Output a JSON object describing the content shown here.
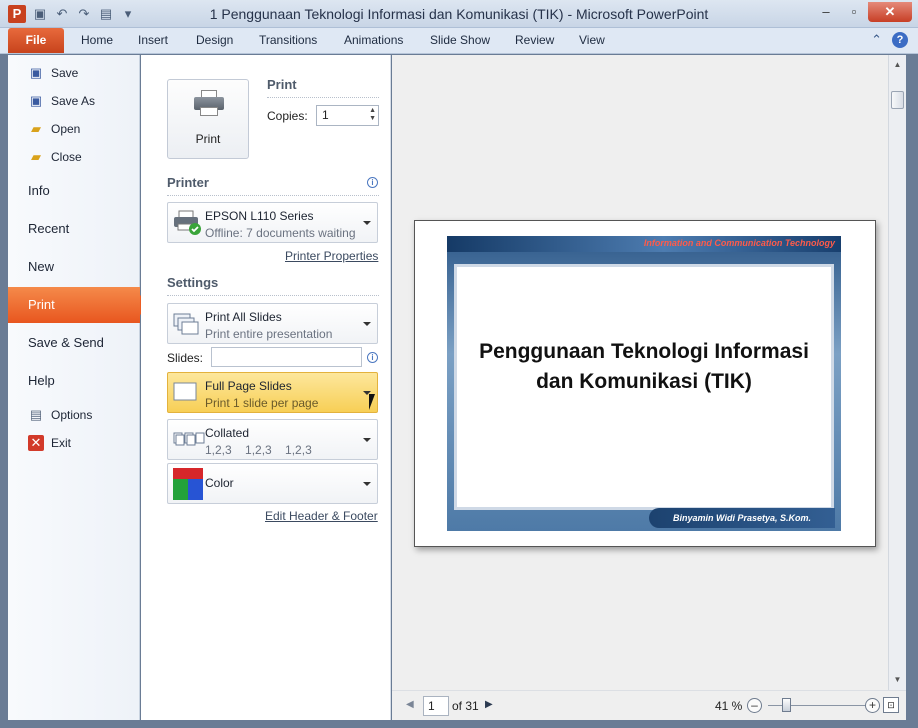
{
  "window": {
    "title": "1 Penggunaan Teknologi Informasi dan Komunikasi (TIK)  -  Microsoft PowerPoint",
    "app_icon_letter": "P"
  },
  "ribbon": {
    "file_label": "File",
    "tabs": [
      "Home",
      "Insert",
      "Design",
      "Transitions",
      "Animations",
      "Slide Show",
      "Review",
      "View"
    ]
  },
  "nav": {
    "commands": [
      {
        "label": "Save",
        "icon": "save-icon"
      },
      {
        "label": "Save As",
        "icon": "save-as-icon"
      },
      {
        "label": "Open",
        "icon": "open-folder-icon"
      },
      {
        "label": "Close",
        "icon": "close-folder-icon"
      }
    ],
    "items": [
      "Info",
      "Recent",
      "New",
      "Print",
      "Save & Send",
      "Help"
    ],
    "lower_commands": [
      {
        "label": "Options",
        "icon": "options-icon"
      },
      {
        "label": "Exit",
        "icon": "exit-icon"
      }
    ]
  },
  "print": {
    "section_title": "Print",
    "button_label": "Print",
    "copies_label": "Copies:",
    "copies_value": "1"
  },
  "printer": {
    "section_title": "Printer",
    "name": "EPSON L110 Series",
    "status": "Offline: 7 documents waiting",
    "properties_link": "Printer Properties"
  },
  "settings": {
    "section_title": "Settings",
    "slides_range": {
      "title": "Print All Slides",
      "subtitle": "Print entire presentation"
    },
    "slides_label": "Slides:",
    "slides_value": "",
    "layout": {
      "title": "Full Page Slides",
      "subtitle": "Print 1 slide per page"
    },
    "collation": {
      "title": "Collated",
      "subtitle": "1,2,3    1,2,3    1,2,3"
    },
    "color": {
      "title": "Color"
    },
    "header_footer_link": "Edit Header & Footer"
  },
  "preview": {
    "slide_banner": "Information and Communication Technology",
    "slide_title": "Penggunaan Teknologi Informasi dan Komunikasi (TIK)",
    "slide_author": "Binyamin Widi Prasetya, S.Kom."
  },
  "pager": {
    "current_page": "1",
    "of_label": "of 31"
  },
  "zoom": {
    "percent_label": "41 %",
    "level_fraction": 0.41
  },
  "colors": {
    "file_tab": "#d9522a",
    "print_nav": "#ee6a2c",
    "hot_dropdown": "#f9d86a"
  }
}
